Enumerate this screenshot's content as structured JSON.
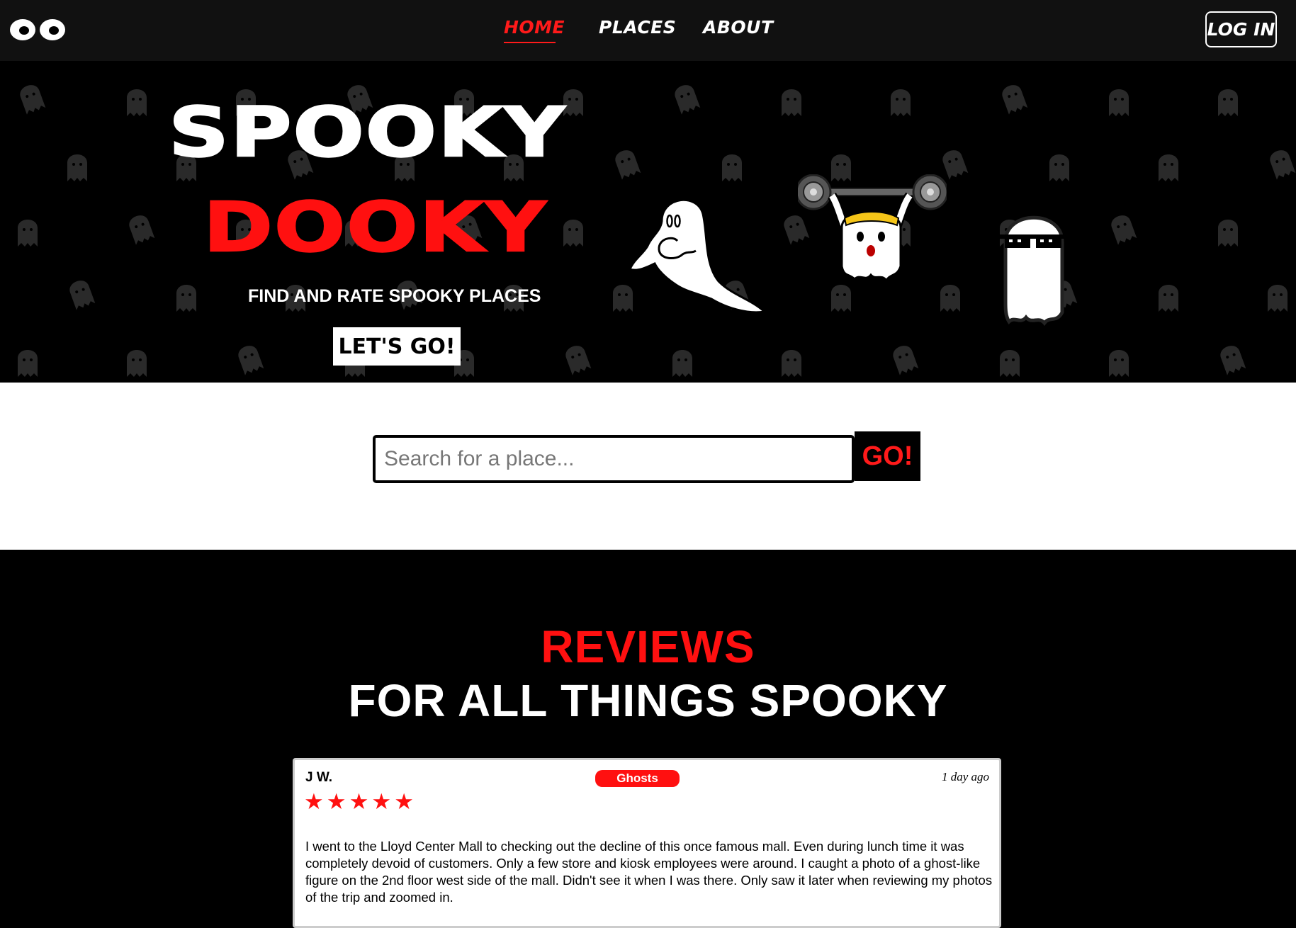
{
  "nav": {
    "links": [
      {
        "label": "HOME",
        "active": true
      },
      {
        "label": "PLACES",
        "active": false
      },
      {
        "label": "ABOUT",
        "active": false
      }
    ],
    "login_label": "LOG IN"
  },
  "hero": {
    "title_line1": "SPOOKY",
    "title_line2": "DOOKY",
    "subtitle": "FIND AND RATE SPOOKY PLACES",
    "cta_label": "LET'S GO!"
  },
  "search": {
    "placeholder": "Search for a place...",
    "value": "",
    "button_label": "GO!"
  },
  "reviews": {
    "heading": "REVIEWS",
    "subheading": "FOR ALL THINGS SPOOKY",
    "items": [
      {
        "author": "J W.",
        "tag": "Ghosts",
        "time": "1 day ago",
        "rating": 5,
        "text": "I went to the Lloyd Center Mall to checking out the decline of this once famous mall. Even during lunch time it was completely devoid of customers. Only a few store and kiosk employees were around. I caught a photo of a ghost-like figure on the 2nd floor west side of the mall. Didn't see it when I was there. Only saw it later when reviewing my photos of the trip and zoomed in."
      }
    ]
  },
  "colors": {
    "accent": "#ff1010",
    "nav_bg": "#111111",
    "hero_bg": "#000000",
    "pattern_ghost": "#2a2a2a"
  }
}
